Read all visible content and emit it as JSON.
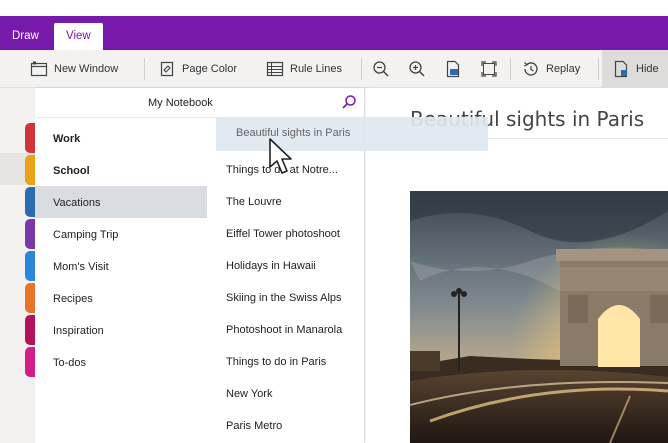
{
  "ribbon": {
    "tabs": [
      {
        "label": "Draw",
        "active": false
      },
      {
        "label": "View",
        "active": true
      }
    ],
    "accent": "#7719aa"
  },
  "toolbar": {
    "new_window": "New Window",
    "page_color": "Page Color",
    "rule_lines": "Rule Lines",
    "replay": "Replay",
    "hide": "Hide"
  },
  "notebook": {
    "title": "My Notebook"
  },
  "sections": [
    {
      "label": "Work",
      "color": "#d13438",
      "bold": true
    },
    {
      "label": "School",
      "color": "#e8a317",
      "bold": true
    },
    {
      "label": "Vacations",
      "color": "#2b6cb0",
      "bold": false,
      "selected": true
    },
    {
      "label": "Camping Trip",
      "color": "#7a38a8",
      "bold": false
    },
    {
      "label": "Mom's Visit",
      "color": "#2b88d8",
      "bold": false
    },
    {
      "label": "Recipes",
      "color": "#e8742a",
      "bold": false
    },
    {
      "label": "Inspiration",
      "color": "#b4125c",
      "bold": false
    },
    {
      "label": "To-dos",
      "color": "#d61e8a",
      "bold": false
    }
  ],
  "pages": [
    {
      "label": "Things to do at Notre..."
    },
    {
      "label": "The Louvre"
    },
    {
      "label": "Eiffel Tower photoshoot"
    },
    {
      "label": "Holidays in Hawaii"
    },
    {
      "label": "Skiing in the Swiss Alps"
    },
    {
      "label": "Photoshoot in Manarola"
    },
    {
      "label": "Things to do in Paris"
    },
    {
      "label": "New York"
    },
    {
      "label": "Paris Metro"
    }
  ],
  "dragging_page": {
    "label": "Beautiful sights in Paris"
  },
  "content": {
    "page_title": "Beautiful sights in Paris"
  }
}
